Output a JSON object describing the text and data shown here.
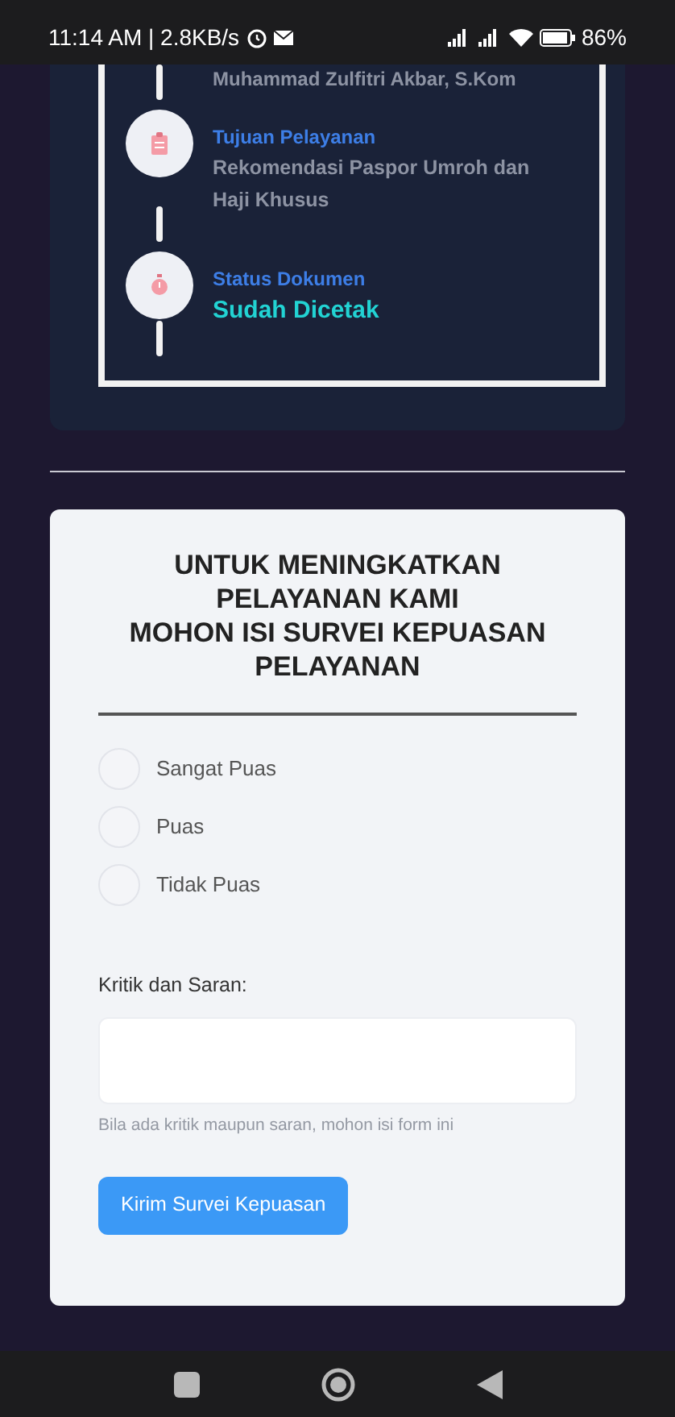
{
  "status_bar": {
    "time": "11:14 AM | 2.8KB/s",
    "battery": "86%"
  },
  "timeline": [
    {
      "kind": "cut",
      "value": "Muhammad Zulfitri Akbar, S.Kom"
    },
    {
      "kind": "item",
      "label": "Tujuan Pelayanan",
      "value": "Rekomendasi Paspor Umroh dan Haji Khusus",
      "highlight": false
    },
    {
      "kind": "item",
      "label": "Status Dokumen",
      "value": "Sudah Dicetak",
      "highlight": true
    }
  ],
  "survey": {
    "title_lines": [
      "UNTUK MENINGKATKAN",
      "PELAYANAN KAMI",
      "MOHON ISI SURVEI KEPUASAN",
      "PELAYANAN"
    ],
    "options": [
      {
        "label": "Sangat Puas",
        "selected": false
      },
      {
        "label": "Puas",
        "selected": false
      },
      {
        "label": "Tidak Puas",
        "selected": false
      }
    ],
    "comment_label": "Kritik dan Saran:",
    "comment_help": "Bila ada kritik maupun saran, mohon isi form ini",
    "submit": "Kirim Survei Kepuasan"
  }
}
